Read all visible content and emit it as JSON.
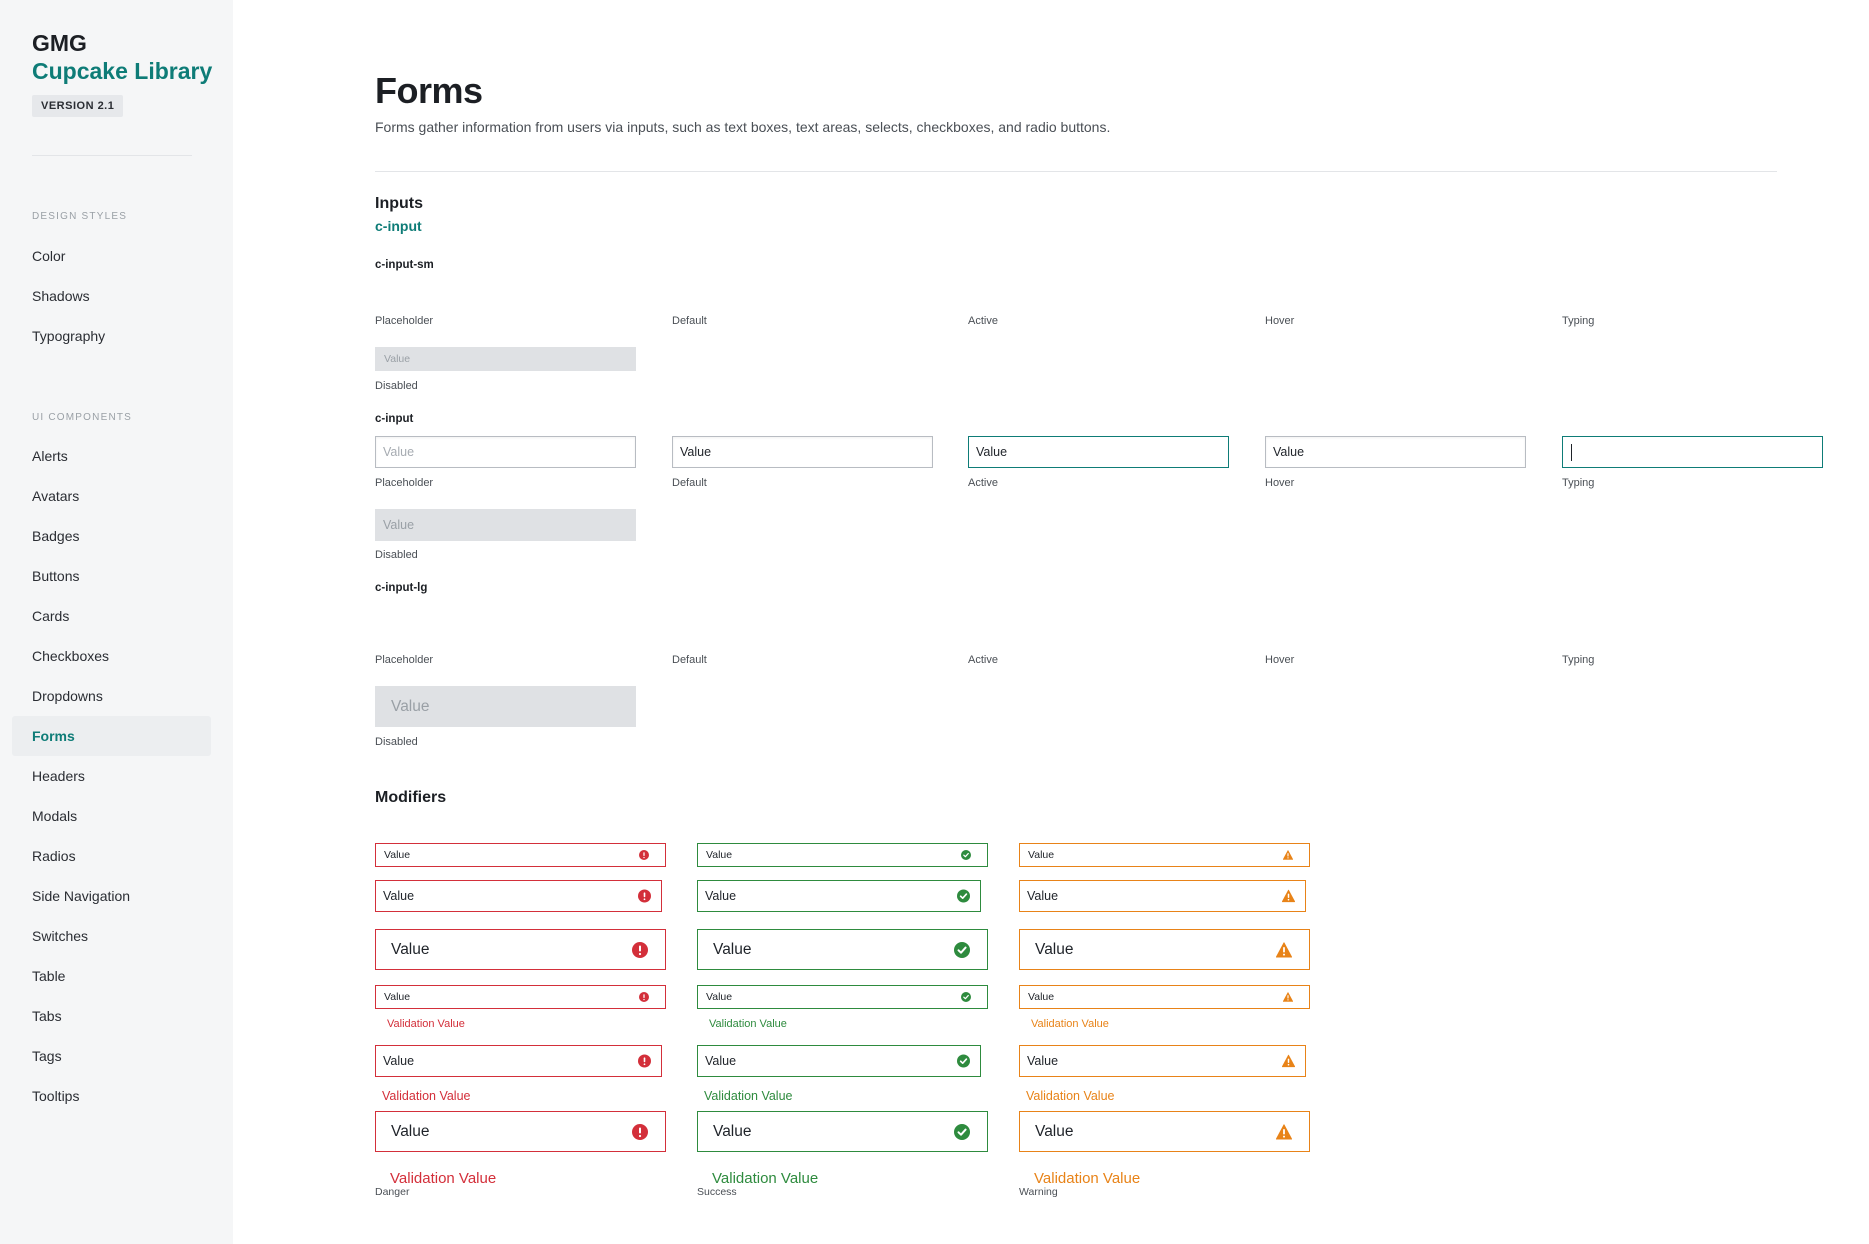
{
  "brand": {
    "org": "GMG",
    "name": "Cupcake Library",
    "version": "VERSION 2.1"
  },
  "sidebar": {
    "design_section": "DESIGN STYLES",
    "design_items": [
      "Color",
      "Shadows",
      "Typography"
    ],
    "ui_section": "UI COMPONENTS",
    "ui_items": [
      "Alerts",
      "Avatars",
      "Badges",
      "Buttons",
      "Cards",
      "Checkboxes",
      "Dropdowns",
      "Forms",
      "Headers",
      "Modals",
      "Radios",
      "Side Navigation",
      "Switches",
      "Table",
      "Tabs",
      "Tags",
      "Tooltips"
    ],
    "active": "Forms"
  },
  "page": {
    "title": "Forms",
    "description": "Forms gather information from users via inputs, such as text boxes, text areas, selects, checkboxes, and radio buttons."
  },
  "inputs": {
    "heading": "Inputs",
    "class_name": "c-input",
    "states": [
      "Placeholder",
      "Default",
      "Active",
      "Hover",
      "Typing"
    ],
    "disabled_label": "Disabled",
    "value": "Value",
    "sizes": {
      "sm": "c-input-sm",
      "md": "c-input",
      "lg": "c-input-lg"
    }
  },
  "modifiers": {
    "heading": "Modifiers",
    "value": "Value",
    "validation": "Validation Value",
    "labels": {
      "danger": "Danger",
      "success": "Success",
      "warning": "Warning"
    },
    "colors": {
      "danger": "#d32f3a",
      "success": "#2e8b3e",
      "warning": "#e88318"
    },
    "icons": {
      "danger": "exclamation-circle-icon",
      "success": "check-circle-icon",
      "warning": "warning-triangle-icon"
    }
  }
}
